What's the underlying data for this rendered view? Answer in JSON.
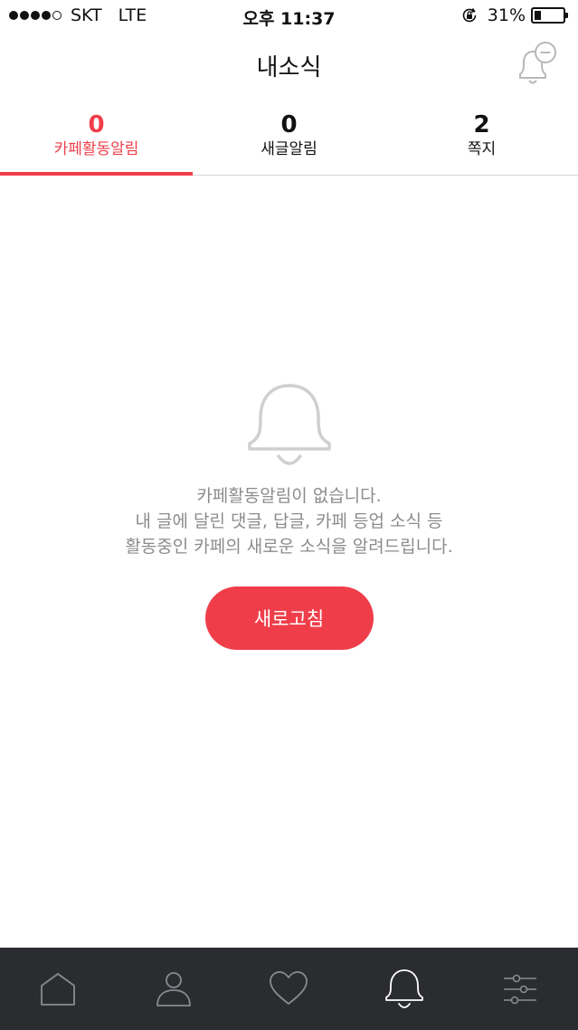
{
  "status_bar": {
    "carrier": "SKT",
    "network": "LTE",
    "time": "오후 11:37",
    "battery_percent": "31%",
    "battery_level": 0.31,
    "signal_bars_filled": 4,
    "signal_bars_total": 5
  },
  "header": {
    "title": "내소식",
    "action_icon": "bell-minus-icon"
  },
  "tabs": [
    {
      "count": "0",
      "label": "카페활동알림",
      "active": true
    },
    {
      "count": "0",
      "label": "새글알림",
      "active": false
    },
    {
      "count": "2",
      "label": "쪽지",
      "active": false
    }
  ],
  "empty_state": {
    "icon": "bell-icon",
    "lines": [
      "카페활동알림이 없습니다.",
      "내 글에 달린 댓글, 답글, 카페 등업 소식 등",
      "활동중인 카페의 새로운 소식을 알려드립니다."
    ],
    "button_label": "새로고침"
  },
  "bottom_nav": {
    "items": [
      {
        "icon": "home-icon",
        "active": false
      },
      {
        "icon": "person-icon",
        "active": false
      },
      {
        "icon": "heart-icon",
        "active": false
      },
      {
        "icon": "bell-icon",
        "active": true
      },
      {
        "icon": "sliders-icon",
        "active": false
      }
    ]
  },
  "colors": {
    "accent": "#ef3e4a",
    "nav_background": "#2b2c30",
    "nav_icon": "#8a8b90",
    "nav_icon_active": "#ffffff",
    "muted_text": "#8c8c8c"
  }
}
